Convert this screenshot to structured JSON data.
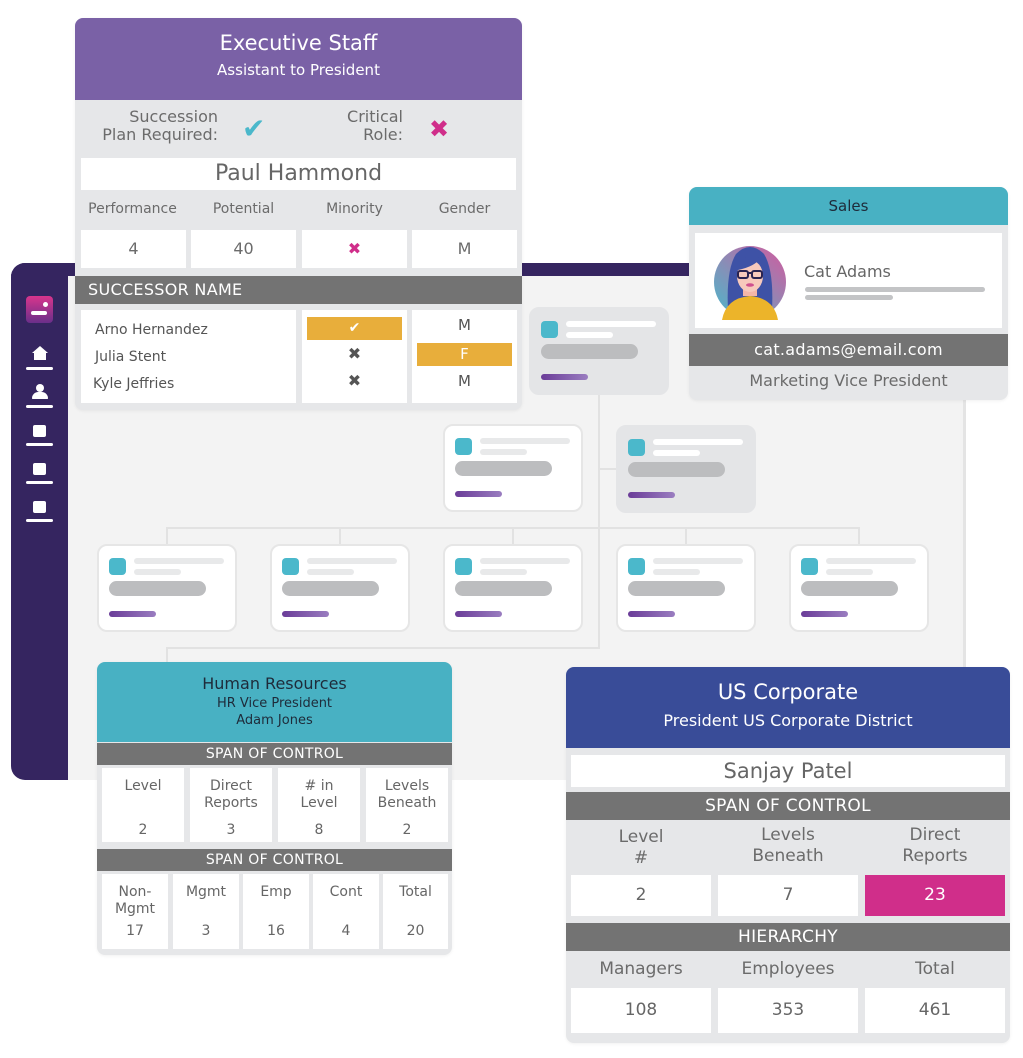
{
  "sidebar": {
    "items": [
      {
        "name": "logo",
        "icon": "app-logo-icon"
      },
      {
        "name": "home",
        "icon": "home-icon"
      },
      {
        "name": "people",
        "icon": "person-icon"
      },
      {
        "name": "item-3",
        "icon": "square-icon"
      },
      {
        "name": "item-4",
        "icon": "square-icon"
      },
      {
        "name": "item-5",
        "icon": "square-icon"
      }
    ]
  },
  "executive_card": {
    "department": "Executive Staff",
    "position": "Assistant to President",
    "succession_label": "Succession Plan Required:",
    "succession_label_l1": "Succession",
    "succession_label_l2": "Plan Required:",
    "succession_value": "✔",
    "critical_label_l1": "Critical",
    "critical_label_l2": "Role:",
    "critical_value": "✖",
    "employee_name": "Paul Hammond",
    "columns": [
      "Performance",
      "Potential",
      "Minority",
      "Gender"
    ],
    "values": {
      "performance": "4",
      "potential": "40",
      "minority": "✖",
      "gender": "M"
    },
    "successor_header": "SUCCESSOR NAME",
    "successors": [
      {
        "name": "Arno Hernandez",
        "minority": "✔",
        "gender": "M"
      },
      {
        "name": "Julia Stent",
        "minority": "✖",
        "gender": "F"
      },
      {
        "name": "Kyle Jeffries",
        "minority": "✖",
        "gender": "M"
      }
    ]
  },
  "sales_card": {
    "department": "Sales",
    "name": "Cat Adams",
    "email": "cat.adams@email.com",
    "title": "Marketing Vice President"
  },
  "hr_card": {
    "department": "Human Resources",
    "position": "HR Vice President",
    "name": "Adam Jones",
    "span1_header": "SPAN OF CONTROL",
    "span1": [
      {
        "label_l1": "Level",
        "label_l2": "",
        "value": "2"
      },
      {
        "label_l1": "Direct",
        "label_l2": "Reports",
        "value": "3"
      },
      {
        "label_l1": "# in",
        "label_l2": "Level",
        "value": "8"
      },
      {
        "label_l1": "Levels",
        "label_l2": "Beneath",
        "value": "2"
      }
    ],
    "span2_header": "SPAN OF CONTROL",
    "span2": [
      {
        "label_l1": "Non-",
        "label_l2": "Mgmt",
        "value": "17"
      },
      {
        "label_l1": "Mgmt",
        "label_l2": "",
        "value": "3"
      },
      {
        "label_l1": "Emp",
        "label_l2": "",
        "value": "16"
      },
      {
        "label_l1": "Cont",
        "label_l2": "",
        "value": "4"
      },
      {
        "label_l1": "Total",
        "label_l2": "",
        "value": "20"
      }
    ]
  },
  "us_corporate_card": {
    "department": "US Corporate",
    "position": "President US Corporate District",
    "name": "Sanjay Patel",
    "span_header": "SPAN OF CONTROL",
    "span": [
      {
        "label_l1": "Level",
        "label_l2": "#",
        "value": "2"
      },
      {
        "label_l1": "Levels",
        "label_l2": "Beneath",
        "value": "7"
      },
      {
        "label_l1": "Direct",
        "label_l2": "Reports",
        "value": "23",
        "highlight": true
      }
    ],
    "hierarchy_header": "HIERARCHY",
    "hierarchy": [
      {
        "label": "Managers",
        "value": "108"
      },
      {
        "label": "Employees",
        "value": "353"
      },
      {
        "label": "Total",
        "value": "461"
      }
    ]
  },
  "colors": {
    "sidebar": "#352560",
    "executive_header": "#7a61a6",
    "teal_header": "#48b1c3",
    "us_corporate_header": "#394c98",
    "section_bar": "#737373",
    "check": "#4bb8cb",
    "cross": "#d02e8a",
    "highlight_yellow": "#e8ae3b",
    "highlight_pink": "#d02e8a"
  }
}
